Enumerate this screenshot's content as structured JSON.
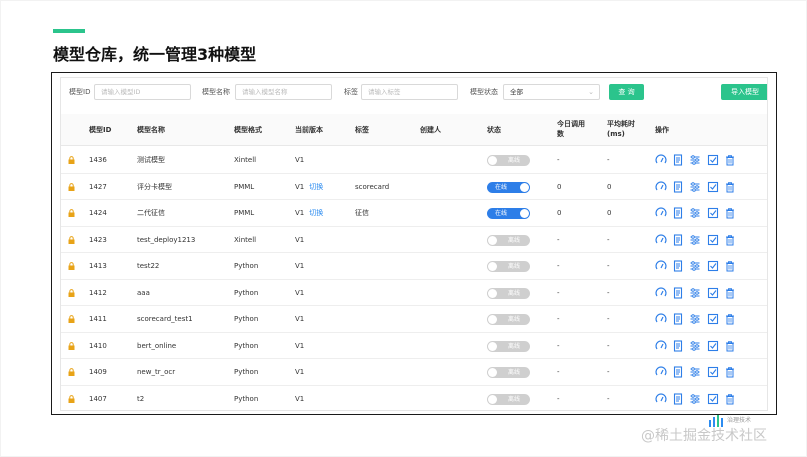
{
  "slide": {
    "title": "模型仓库，统一管理3种模型"
  },
  "filters": {
    "model_id_label": "模型ID",
    "model_id_placeholder": "请输入模型ID",
    "model_name_label": "模型名称",
    "model_name_placeholder": "请输入模型名称",
    "tag_label": "标签",
    "tag_placeholder": "请输入标签",
    "status_label": "模型状态",
    "status_value": "全部",
    "query_button": "查 询",
    "import_button": "导入模型"
  },
  "table": {
    "headers": {
      "id": "模型ID",
      "name": "模型名称",
      "format": "模型格式",
      "version": "当前版本",
      "tag": "标签",
      "creator": "创建人",
      "status": "状态",
      "calls_today_line1": "今日调用",
      "calls_today_line2": "数",
      "avg_time_line1": "平均耗时",
      "avg_time_line2": "(ms)",
      "actions": "操作"
    },
    "switch_link": "切换",
    "rows": [
      {
        "id": "1436",
        "name": "测试模型",
        "format": "Xintell",
        "version": "V1",
        "switch": "",
        "tag": "",
        "creator": "",
        "online": false,
        "status": "离线",
        "calls": "-",
        "avg": "-"
      },
      {
        "id": "1427",
        "name": "评分卡模型",
        "format": "PMML",
        "version": "V1",
        "switch": "切换",
        "tag": "scorecard",
        "creator": "",
        "online": true,
        "status": "在线",
        "calls": "0",
        "avg": "0"
      },
      {
        "id": "1424",
        "name": "二代征信",
        "format": "PMML",
        "version": "V1",
        "switch": "切换",
        "tag": "征信",
        "creator": "",
        "online": true,
        "status": "在线",
        "calls": "0",
        "avg": "0"
      },
      {
        "id": "1423",
        "name": "test_deploy1213",
        "format": "Xintell",
        "version": "V1",
        "switch": "",
        "tag": "",
        "creator": "",
        "online": false,
        "status": "离线",
        "calls": "-",
        "avg": "-"
      },
      {
        "id": "1413",
        "name": "test22",
        "format": "Python",
        "version": "V1",
        "switch": "",
        "tag": "",
        "creator": "",
        "online": false,
        "status": "离线",
        "calls": "-",
        "avg": "-"
      },
      {
        "id": "1412",
        "name": "aaa",
        "format": "Python",
        "version": "V1",
        "switch": "",
        "tag": "",
        "creator": "",
        "online": false,
        "status": "离线",
        "calls": "-",
        "avg": "-"
      },
      {
        "id": "1411",
        "name": "scorecard_test1",
        "format": "Python",
        "version": "V1",
        "switch": "",
        "tag": "",
        "creator": "",
        "online": false,
        "status": "离线",
        "calls": "-",
        "avg": "-"
      },
      {
        "id": "1410",
        "name": "bert_online",
        "format": "Python",
        "version": "V1",
        "switch": "",
        "tag": "",
        "creator": "",
        "online": false,
        "status": "离线",
        "calls": "-",
        "avg": "-"
      },
      {
        "id": "1409",
        "name": "new_tr_ocr",
        "format": "Python",
        "version": "V1",
        "switch": "",
        "tag": "",
        "creator": "",
        "online": false,
        "status": "离线",
        "calls": "-",
        "avg": "-"
      },
      {
        "id": "1407",
        "name": "t2",
        "format": "Python",
        "version": "V1",
        "switch": "",
        "tag": "",
        "creator": "",
        "online": false,
        "status": "离线",
        "calls": "-",
        "avg": "-"
      }
    ],
    "action_icons": [
      "monitor-icon",
      "document-icon",
      "settings-sliders-icon",
      "test-check-icon",
      "delete-icon"
    ]
  },
  "colors": {
    "accent": "#2bc48c",
    "link": "#2d8cf0",
    "toggle_on": "#2d7ee8",
    "toggle_off": "#cfcfcf",
    "lock": "#e8a317"
  },
  "watermark": {
    "text": "@稀土掘金技术社区",
    "logo_text": "治理技术"
  }
}
